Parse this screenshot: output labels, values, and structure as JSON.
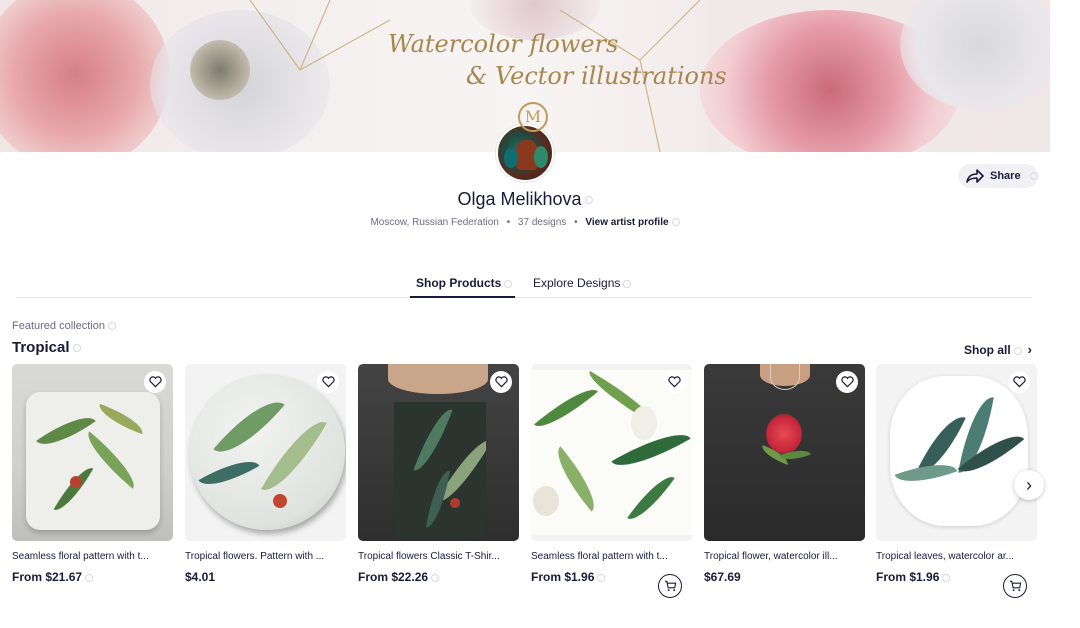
{
  "banner": {
    "line1": "Watercolor flowers",
    "line2": "& Vector illustrations",
    "monogram": "M"
  },
  "share": {
    "label": "Share"
  },
  "artist": {
    "name": "Olga Melikhova",
    "location": "Moscow, Russian Federation",
    "designs": "37 designs",
    "profile_link": "View artist profile"
  },
  "tabs": [
    {
      "label": "Shop Products",
      "active": true
    },
    {
      "label": "Explore Designs",
      "active": false
    }
  ],
  "collection": {
    "kicker": "Featured collection",
    "title": "Tropical",
    "shop_all": "Shop all"
  },
  "products": [
    {
      "title": "Seamless floral pattern with t...",
      "price": "From $21.67",
      "has_cart": false,
      "kind": "pillow"
    },
    {
      "title": "Tropical flowers. Pattern with ...",
      "price": "$4.01",
      "has_cart": false,
      "kind": "button"
    },
    {
      "title": "Tropical flowers Classic T-Shir...",
      "price": "From $22.26",
      "has_cart": false,
      "kind": "tshirt"
    },
    {
      "title": "Seamless floral pattern with t...",
      "price": "From $1.96",
      "has_cart": true,
      "kind": "sticker-square"
    },
    {
      "title": "Tropical flower, watercolor ill...",
      "price": "$67.69",
      "has_cart": false,
      "kind": "sweatshirt"
    },
    {
      "title": "Tropical leaves, watercolor ar...",
      "price": "From $1.96",
      "has_cart": true,
      "kind": "sticker-leaves"
    }
  ],
  "colors": {
    "text": "#1a1a3a",
    "muted": "#6b6b85",
    "gold": "#a8874f",
    "leaf": "#3f7a47"
  }
}
